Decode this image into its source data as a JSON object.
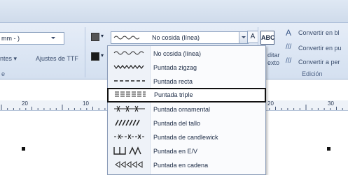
{
  "left_panel": {
    "unit_combo": "mm - )",
    "fonts_label": "ntes",
    "ttf_settings": "Ajustes de TTF",
    "group_label_partial": "e"
  },
  "stitch_combo": {
    "value": "No cosida (línea)"
  },
  "edit_group": {
    "abc_label": "ABC",
    "convert_1": "Convertir en bl",
    "convert_2": "Convertir en pu",
    "convert_3": "Convertir a per",
    "edit_text_1": "ditar",
    "edit_text_2": "exto",
    "group_label": "Edición"
  },
  "ruler": {
    "labels": [
      "20",
      "10",
      "20",
      "30"
    ]
  },
  "menu": {
    "items": [
      {
        "label": "No cosida (línea)",
        "icon": "wavy-line-icon"
      },
      {
        "label": "Puntada zigzag",
        "icon": "zigzag-icon"
      },
      {
        "label": "Puntada recta",
        "icon": "dashed-line-icon"
      },
      {
        "label": "Puntada triple",
        "icon": "triple-line-icon",
        "selected": true
      },
      {
        "label": "Puntada ornamental",
        "icon": "ornamental-icon"
      },
      {
        "label": "Puntada del tallo",
        "icon": "stem-icon"
      },
      {
        "label": "Puntada de candlewick",
        "icon": "candlewick-icon"
      },
      {
        "label": "Puntada en E/V",
        "icon": "ev-icon"
      },
      {
        "label": "Puntada en cadena",
        "icon": "chain-icon"
      }
    ]
  }
}
